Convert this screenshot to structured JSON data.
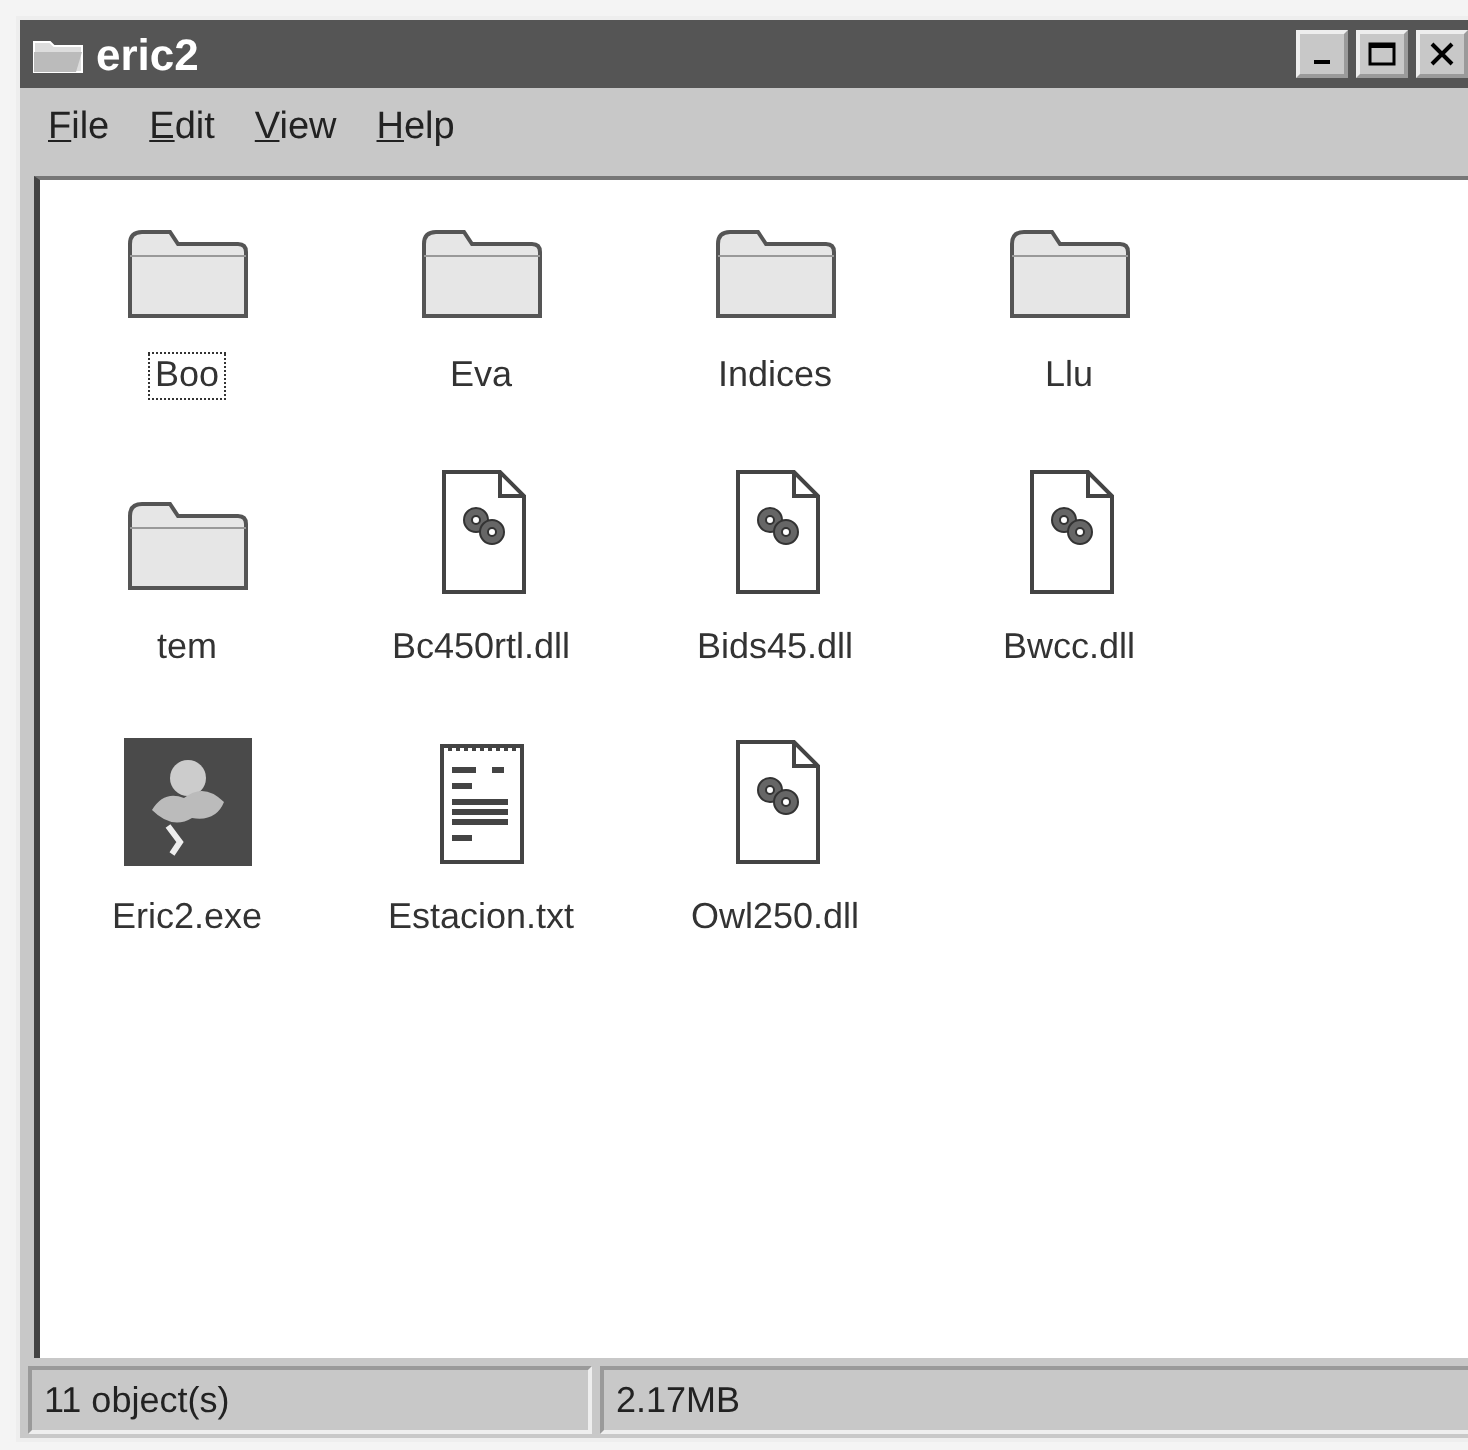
{
  "window": {
    "title": "eric2"
  },
  "menu": [
    {
      "underlined": "F",
      "rest": "ile"
    },
    {
      "underlined": "E",
      "rest": "dit"
    },
    {
      "underlined": "V",
      "rest": "iew"
    },
    {
      "underlined": "H",
      "rest": "elp"
    }
  ],
  "items": [
    {
      "label": "Boo",
      "kind": "folder",
      "focused": true
    },
    {
      "label": "Eva",
      "kind": "folder",
      "focused": false
    },
    {
      "label": "Indices",
      "kind": "folder",
      "focused": false
    },
    {
      "label": "Llu",
      "kind": "folder",
      "focused": false
    },
    {
      "label": "tem",
      "kind": "folder",
      "focused": false
    },
    {
      "label": "Bc450rtl.dll",
      "kind": "dll",
      "focused": false
    },
    {
      "label": "Bids45.dll",
      "kind": "dll",
      "focused": false
    },
    {
      "label": "Bwcc.dll",
      "kind": "dll",
      "focused": false
    },
    {
      "label": "Eric2.exe",
      "kind": "exe",
      "focused": false
    },
    {
      "label": "Estacion.txt",
      "kind": "txt",
      "focused": false
    },
    {
      "label": "Owl250.dll",
      "kind": "dll",
      "focused": false
    }
  ],
  "status_bar": {
    "count": "11 object(s)",
    "size": "2.17MB"
  }
}
